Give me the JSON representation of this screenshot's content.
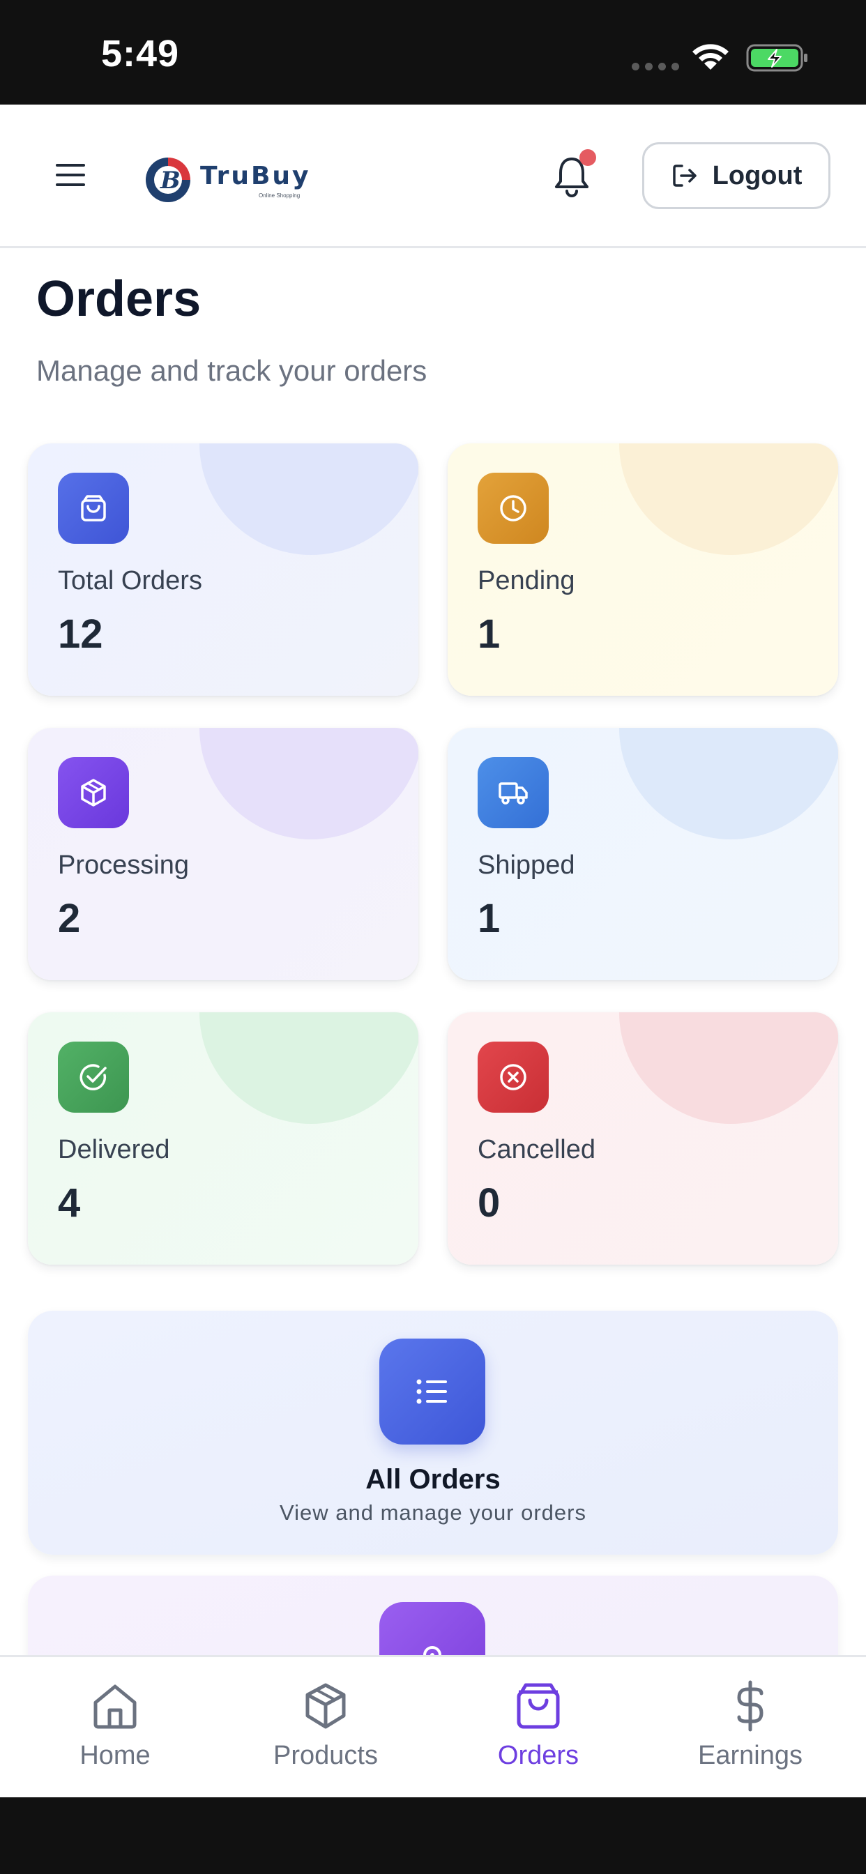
{
  "status_bar": {
    "time": "5:49"
  },
  "header": {
    "brand": "TruBuy",
    "brand_tagline": "Online Shopping",
    "logout_label": "Logout"
  },
  "page": {
    "title": "Orders",
    "subtitle": "Manage and track your orders"
  },
  "stats": [
    {
      "label": "Total Orders",
      "value": "12",
      "icon": "shopping-bag-icon",
      "color": "#4a63e0"
    },
    {
      "label": "Pending",
      "value": "1",
      "icon": "clock-icon",
      "color": "#d9922a"
    },
    {
      "label": "Processing",
      "value": "2",
      "icon": "cube-icon",
      "color": "#7744e6"
    },
    {
      "label": "Shipped",
      "value": "1",
      "icon": "truck-icon",
      "color": "#3f7fdf"
    },
    {
      "label": "Delivered",
      "value": "4",
      "icon": "check-circle-icon",
      "color": "#44a35a"
    },
    {
      "label": "Cancelled",
      "value": "0",
      "icon": "x-circle-icon",
      "color": "#d8393f"
    }
  ],
  "actions": [
    {
      "title": "All Orders",
      "subtitle": "View and manage your orders",
      "icon": "list-icon",
      "color": "#4a63e0"
    },
    {
      "title": "",
      "subtitle": "",
      "icon": "location-pin-icon",
      "color": "#8b4fe0"
    }
  ],
  "bottom_nav": [
    {
      "label": "Home",
      "icon": "home-icon",
      "active": false
    },
    {
      "label": "Products",
      "icon": "cube-icon",
      "active": false
    },
    {
      "label": "Orders",
      "icon": "shopping-bag-icon",
      "active": true
    },
    {
      "label": "Earnings",
      "icon": "dollar-icon",
      "active": false
    }
  ],
  "colors": {
    "accent": "#6d3ee0",
    "notification": "#e55b61",
    "battery": "#4cd964"
  }
}
